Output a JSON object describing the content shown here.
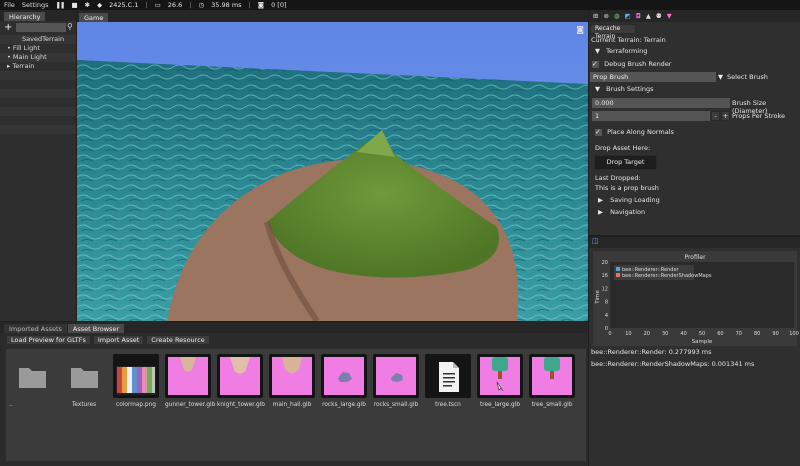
{
  "menubar": {
    "file": "File",
    "settings": "Settings",
    "version": "2425.C.1",
    "fps": "26.6",
    "frame_ms": "35.98 ms",
    "captures": "0 [0]"
  },
  "hierarchy": {
    "tab": "Hierarchy",
    "root": "SavedTerrain",
    "items": [
      "Fill Light",
      "Main Light",
      "Terrain"
    ]
  },
  "viewport": {
    "tab": "Game",
    "camera_icon": "camera-icon"
  },
  "inspector": {
    "recache_button": "Recache Terrain",
    "current_terrain": "Current Terrain: Terrain",
    "terraforming": "Terraforming",
    "debug_brush": "Debug Brush Render",
    "brush_value": "Prop Brush",
    "brush_label": "Select Brush",
    "brush_settings": "Brush Settings",
    "brush_size_value": "0.000",
    "brush_size_label": "Brush Size (Diameter)",
    "props_value": "1",
    "props_label": "Props Per Stroke",
    "minus": "-",
    "plus": "+",
    "place_normals": "Place Along Normals",
    "drop_here": "Drop Asset Here:",
    "drop_target": "Drop Target",
    "last_dropped": "Last Dropped:",
    "last_dropped_value": "This is a prop brush",
    "saving_loading": "Saving Loading",
    "navigation": "Navigation"
  },
  "profiler": {
    "title": "Profiler",
    "legend": [
      "bee::Renderer::Render",
      "bee::Renderer::RenderShadowMaps"
    ],
    "legend_colors": [
      "#5aa0dc",
      "#e07a5a"
    ],
    "ylabel": "Time",
    "xlabel": "Sample",
    "render_line": "bee::Renderer::Render: 0.277993 ms",
    "shadow_line": "bee::Renderer::RenderShadowMaps: 0.001341 ms"
  },
  "chart_data": {
    "type": "line",
    "title": "Profiler",
    "xlabel": "Sample",
    "ylabel": "Time",
    "xlim": [
      0,
      100
    ],
    "ylim": [
      0,
      20
    ],
    "xticks": [
      0,
      10,
      20,
      30,
      40,
      50,
      60,
      70,
      80,
      90,
      100
    ],
    "yticks": [
      0,
      2,
      4,
      6,
      8,
      10,
      12,
      14,
      16,
      18,
      20
    ],
    "series": [
      {
        "name": "bee::Renderer::Render",
        "values": []
      },
      {
        "name": "bee::Renderer::RenderShadowMaps",
        "values": []
      }
    ],
    "legend": "top-left"
  },
  "assets": {
    "tabs": [
      "Imported Assets",
      "Asset Browser"
    ],
    "buttons": [
      "Load Preview for GLTFs",
      "Import Asset",
      "Create Resource"
    ],
    "items": [
      {
        "label": "..",
        "icon": "folder-icon"
      },
      {
        "label": "Textures",
        "icon": "folder-icon"
      },
      {
        "label": "colormap.png",
        "icon": "palette-thumb"
      },
      {
        "label": "gunner_tower.glb",
        "icon": "tower-thumb"
      },
      {
        "label": "knight_tower.glb",
        "icon": "tower-thumb"
      },
      {
        "label": "main_hall.glb",
        "icon": "tower-thumb"
      },
      {
        "label": "rocks_large.glb",
        "icon": "rocks-thumb"
      },
      {
        "label": "rocks_small.glb",
        "icon": "rocks-thumb"
      },
      {
        "label": "tree.tscn",
        "icon": "document-icon"
      },
      {
        "label": "tree_large.glb",
        "icon": "tree-thumb"
      },
      {
        "label": "tree_small.glb",
        "icon": "tree-thumb"
      }
    ]
  }
}
